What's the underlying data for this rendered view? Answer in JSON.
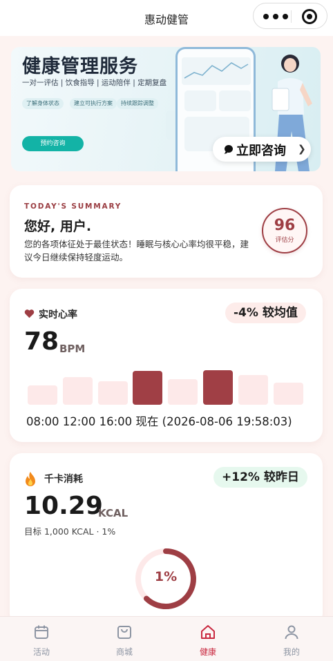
{
  "navbar": {
    "title": "惠动健管",
    "more_icon": "more-dots-icon",
    "close_icon": "target-circle-icon"
  },
  "banner": {
    "title": "健康管理服务",
    "subtitle": "一对一评估 | 饮食指导 | 运动陪伴 | 定期复盘",
    "chips": [
      "了解身体状态",
      "建立可执行方案",
      "持续跟踪调整"
    ],
    "cta_label": "预约咨询",
    "consult_label": "立即咨询",
    "consult_icon": "chat-bubble-icon"
  },
  "summary": {
    "label": "TODAY'S SUMMARY",
    "greeting": "您好, 用户.",
    "description": "您的各项体征处于最佳状态！睡眠与核心心率均很平稳，建议今日继续保持轻度运动。",
    "score_value": "96",
    "score_label": "评估分"
  },
  "heart_rate": {
    "icon": "heart-icon",
    "title": "实时心率",
    "comparison": "-4% 较均值",
    "value": "78",
    "unit": "BPM",
    "time_axis": "08:00 12:00 16:00 现在 (2026-08-06 19:58:03)",
    "accent_color": "#a03f45",
    "bar_color": "#fde9e9",
    "bars": [
      {
        "level": 0.55,
        "active": false
      },
      {
        "level": 0.8,
        "active": false
      },
      {
        "level": 0.68,
        "active": false
      },
      {
        "level": 0.98,
        "active": true
      },
      {
        "level": 0.74,
        "active": false
      },
      {
        "level": 1.0,
        "active": true
      },
      {
        "level": 0.86,
        "active": false
      },
      {
        "level": 0.63,
        "active": false
      }
    ]
  },
  "calories": {
    "icon": "fire-icon",
    "title": "千卡消耗",
    "comparison": "+12% 较昨日",
    "value": "10.29",
    "unit": "KCAL",
    "target_text": "目标 1,000 KCAL · 1%",
    "progress_percent": "1%",
    "ring_color": "#9e3e44"
  },
  "tabbar": {
    "active_color": "#c9283f",
    "tabs": [
      {
        "label": "活动",
        "icon": "calendar-icon",
        "active": false
      },
      {
        "label": "商城",
        "icon": "shopping-bag-icon",
        "active": false
      },
      {
        "label": "健康",
        "icon": "home-icon",
        "active": true
      },
      {
        "label": "我的",
        "icon": "user-icon",
        "active": false
      }
    ]
  }
}
